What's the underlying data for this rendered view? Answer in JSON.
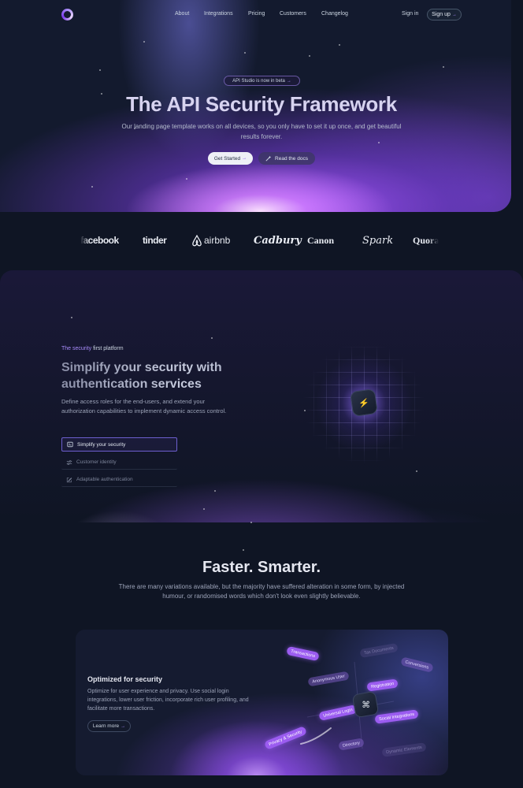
{
  "nav": {
    "links": [
      "About",
      "Integrations",
      "Pricing",
      "Customers",
      "Changelog"
    ],
    "signin": "Sign in",
    "signup": "Sign up",
    "arrow": "→"
  },
  "hero": {
    "badge": "API Studio is now in beta",
    "title": "The API Security Framework",
    "subtitle": "Our landing page template works on all devices, so you only have to set it up once, and get beautiful results forever.",
    "primary_cta": "Get Started",
    "secondary_cta": "Read the docs"
  },
  "logos": [
    "facebook",
    "tinder",
    "airbnb",
    "Cadbury",
    "Canon",
    "Spark",
    "Quora"
  ],
  "feature": {
    "kicker_accent": "The security",
    "kicker_rest": " first platform",
    "title": "Simplify your security with authentication services",
    "description": "Define access roles for the end-users, and extend your authorization capabilities to implement dynamic access control.",
    "tabs": [
      {
        "label": "Simplify your security",
        "icon": "terminal-icon",
        "active": true
      },
      {
        "label": "Customer identity",
        "icon": "sliders-icon",
        "active": false
      },
      {
        "label": "Adaptable authentication",
        "icon": "edit-icon",
        "active": false
      }
    ],
    "center_glyph": "⚡"
  },
  "faster": {
    "title": "Faster. Smarter.",
    "subtitle": "There are many variations available, but the majority have suffered alteration in some form, by injected humour, or randomised words which don't look even slightly believable."
  },
  "card": {
    "title": "Optimized for security",
    "description": "Optimize for user experience and privacy. Use social login integrations, lower user friction, incorporate rich user profiling, and facilitate more transactions.",
    "cta": "Learn more",
    "center_glyph": "⌘",
    "chips": [
      "Transactions",
      "Tax Documents",
      "Conversions",
      "Anonymous User",
      "Registration",
      "Universal Login",
      "Social Integrations",
      "Privacy & Security",
      "Directory",
      "Dynamic Elements"
    ]
  },
  "colors": {
    "background": "#0f1524",
    "accent": "#a78bfa",
    "chip": "#9b5cf0"
  }
}
